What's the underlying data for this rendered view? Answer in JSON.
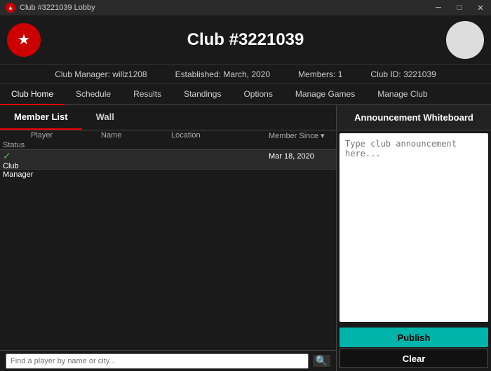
{
  "titleBar": {
    "title": "Club #3221039 Lobby",
    "minimizeLabel": "─",
    "maximizeLabel": "□",
    "closeLabel": "✕"
  },
  "header": {
    "clubName": "Club #3221039",
    "logo": "★",
    "infoBar": {
      "manager": "Club Manager: willz1208",
      "established": "Established: March, 2020",
      "members": "Members: 1",
      "clubId": "Club ID: 3221039"
    }
  },
  "nav": {
    "tabs": [
      {
        "label": "Club Home",
        "active": true
      },
      {
        "label": "Schedule",
        "active": false
      },
      {
        "label": "Results",
        "active": false
      },
      {
        "label": "Standings",
        "active": false
      },
      {
        "label": "Options",
        "active": false
      },
      {
        "label": "Manage Games",
        "active": false
      },
      {
        "label": "Manage Club",
        "active": false
      }
    ]
  },
  "subTabs": [
    {
      "label": "Member List",
      "active": true
    },
    {
      "label": "Wall",
      "active": false
    }
  ],
  "table": {
    "headers": [
      {
        "label": "",
        "sortable": false
      },
      {
        "label": "Player",
        "sortable": false
      },
      {
        "label": "Name",
        "sortable": false
      },
      {
        "label": "Location",
        "sortable": false
      },
      {
        "label": "Member Since",
        "sortable": true
      },
      {
        "label": "Status",
        "sortable": false
      }
    ],
    "rows": [
      {
        "selected": true,
        "check": "✓",
        "player": "",
        "name": "",
        "location": "",
        "memberSince": "Mar 18, 2020",
        "status": "Club Manager"
      }
    ]
  },
  "search": {
    "placeholder": "Find a player by name or city...",
    "value": "",
    "iconLabel": "🔍"
  },
  "whiteboard": {
    "title": "Announcement Whiteboard",
    "placeholder": "Type club announcement here...",
    "publishLabel": "Publish",
    "clearLabel": "Clear"
  }
}
